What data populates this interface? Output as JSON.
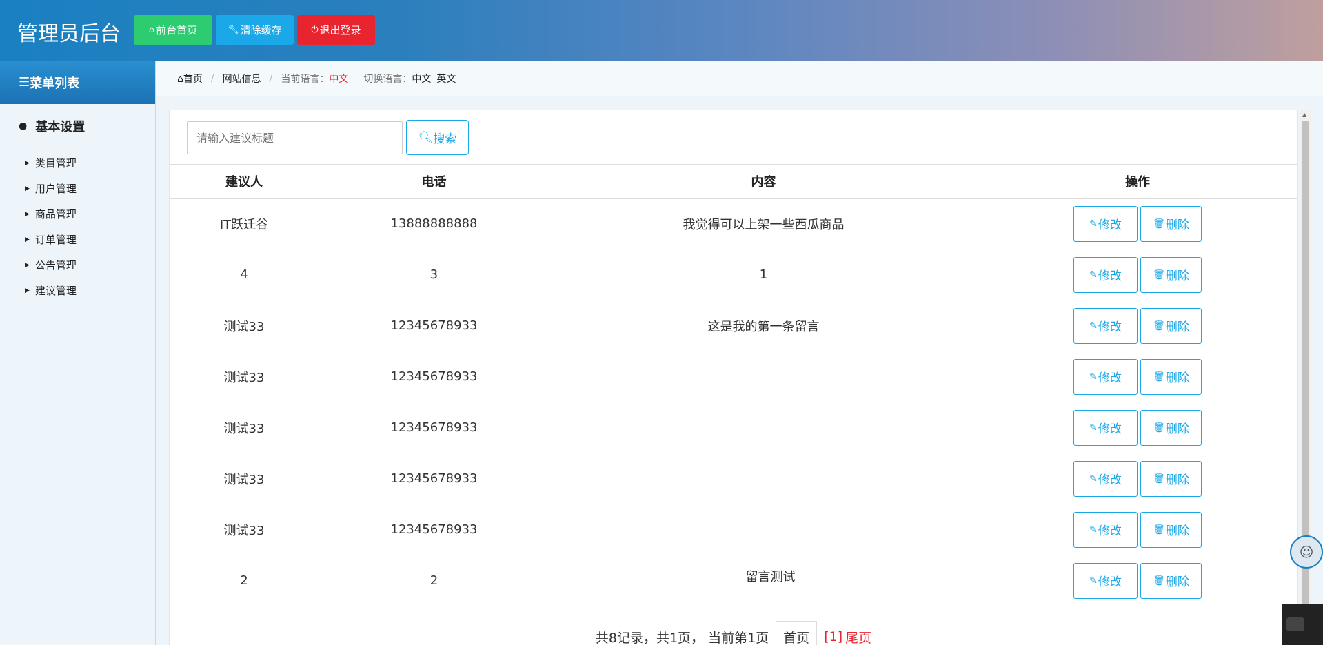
{
  "header": {
    "brand": "管理员后台",
    "buttons": {
      "home": "前台首页",
      "clear_cache": "清除缓存",
      "logout": "退出登录"
    }
  },
  "sidebar": {
    "heading": "菜单列表",
    "group": "基本设置",
    "items": [
      {
        "label": "类目管理"
      },
      {
        "label": "用户管理"
      },
      {
        "label": "商品管理"
      },
      {
        "label": "订单管理"
      },
      {
        "label": "公告管理"
      },
      {
        "label": "建议管理"
      }
    ]
  },
  "breadcrumb": {
    "home": "首页",
    "site_info": "网站信息",
    "current_lang_label": "当前语言：",
    "current_lang": "中文",
    "switch_label": "切换语言：",
    "lang_zh": "中文",
    "lang_en": "英文"
  },
  "search": {
    "placeholder": "请输入建议标题",
    "button": "搜索"
  },
  "table": {
    "headers": [
      "建议人",
      "电话",
      "内容",
      "操作"
    ],
    "edit_label": "修改",
    "delete_label": "删除",
    "rows": [
      {
        "name": "IT跃迁谷",
        "phone": "13888888888",
        "content": "我觉得可以上架一些西瓜商品"
      },
      {
        "name": "4",
        "phone": "3",
        "content": "1"
      },
      {
        "name": "测试33",
        "phone": "12345678933",
        "content": "这是我的第一条留言"
      },
      {
        "name": "测试33",
        "phone": "12345678933",
        "content": ""
      },
      {
        "name": "测试33",
        "phone": "12345678933",
        "content": ""
      },
      {
        "name": "测试33",
        "phone": "12345678933",
        "content": ""
      },
      {
        "name": "测试33",
        "phone": "12345678933",
        "content": ""
      },
      {
        "name": "2",
        "phone": "2",
        "content": "留言测试"
      }
    ]
  },
  "pager": {
    "summary": "共8记录，共1页， 当前第1页",
    "first": "首页",
    "current": "[1]",
    "last": "尾页"
  },
  "colors": {
    "green": "#2ecc71",
    "blue": "#1ba8e8",
    "red": "#e8252f"
  }
}
